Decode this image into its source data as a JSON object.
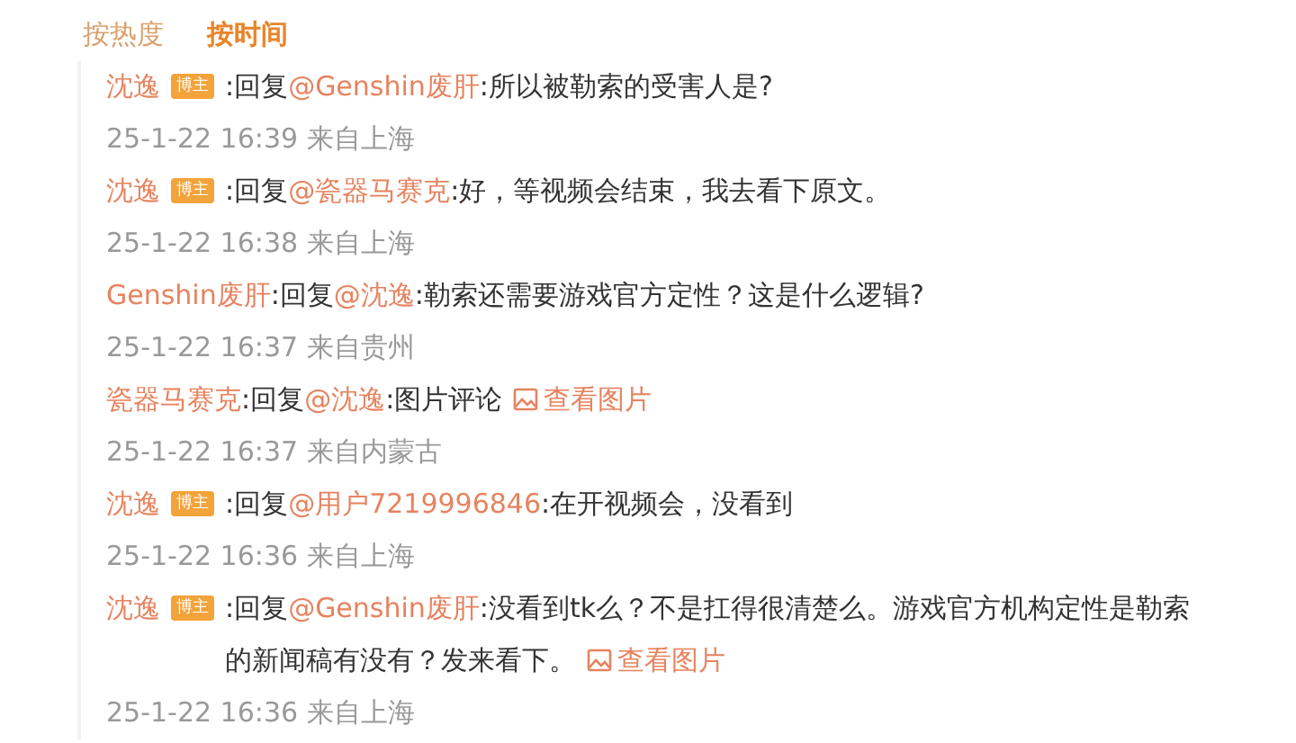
{
  "tabs": [
    {
      "label": "按热度",
      "selected": false
    },
    {
      "label": "按时间",
      "selected": true
    }
  ],
  "comments": [
    {
      "author": "沈逸",
      "badge": "博主",
      "reply_prefix": ":回复",
      "reply_to": "@Genshin废肝",
      "text": ":所以被勒索的受害人是?",
      "time": "25-1-22 16:39",
      "location": "来自上海"
    },
    {
      "author": "沈逸",
      "badge": "博主",
      "reply_prefix": ":回复",
      "reply_to": "@瓷器马赛克",
      "text": ":好，等视频会结束，我去看下原文。",
      "time": "25-1-22 16:38",
      "location": "来自上海"
    },
    {
      "author": "Genshin废肝",
      "reply_prefix": ":回复",
      "reply_to": "@沈逸",
      "text": ":勒索还需要游戏官方定性？这是什么逻辑?",
      "time": "25-1-22 16:37",
      "location": "来自贵州"
    },
    {
      "author": "瓷器马赛克",
      "reply_prefix": ":回复",
      "reply_to": "@沈逸",
      "text": ":图片评论",
      "image_link": "查看图片",
      "time": "25-1-22 16:37",
      "location": "来自内蒙古"
    },
    {
      "author": "沈逸",
      "badge": "博主",
      "reply_prefix": ":回复",
      "reply_to": "@用户7219996846",
      "text": ":在开视频会，没看到",
      "time": "25-1-22 16:36",
      "location": "来自上海"
    },
    {
      "author": "沈逸",
      "badge": "博主",
      "reply_prefix": ":回复",
      "reply_to": "@Genshin废肝",
      "text": ":没看到tk么？不是扛得很清楚么。游戏官方机构定性是勒索的新闻稿有没有？发来看下。",
      "image_link": "查看图片",
      "time": "25-1-22 16:36",
      "location": "来自上海"
    }
  ]
}
